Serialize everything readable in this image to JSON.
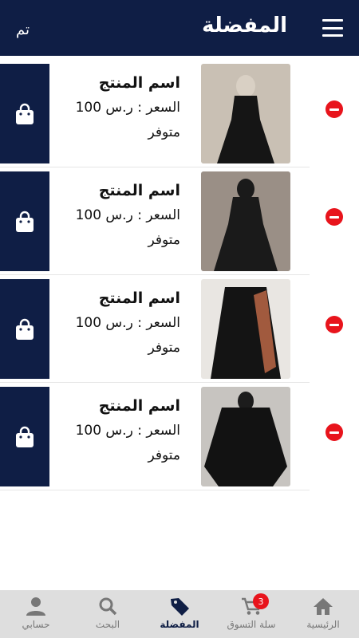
{
  "header": {
    "title": "المفضلة",
    "done_label": "تم"
  },
  "products": [
    {
      "name": "اسم المنتج",
      "price": "السعر : ر.س 100",
      "stock": "متوفر",
      "bg": "#c9c0b4",
      "garment": "#151515",
      "head": "#d9d0c4"
    },
    {
      "name": "اسم المنتج",
      "price": "السعر : ر.س 100",
      "stock": "متوفر",
      "bg": "#9a8f86",
      "garment": "#1a1a1a",
      "head": "#1a1a1a"
    },
    {
      "name": "اسم المنتج",
      "price": "السعر : ر.س 100",
      "stock": "متوفر",
      "bg": "#e9e6e2",
      "garment": "#141414",
      "head": "#a15a3e"
    },
    {
      "name": "اسم المنتج",
      "price": "السعر : ر.س 100",
      "stock": "متوفر",
      "bg": "#c7c4c0",
      "garment": "#121212",
      "head": "#1c1c1c"
    }
  ],
  "bottom_nav": [
    {
      "label": "الرئيسية",
      "icon": "home-icon"
    },
    {
      "label": "سلة التسوق",
      "icon": "cart-icon",
      "badge": "3"
    },
    {
      "label": "المفضلة",
      "icon": "tag-icon",
      "active": true
    },
    {
      "label": "البحث",
      "icon": "search-icon"
    },
    {
      "label": "حسابي",
      "icon": "person-icon"
    }
  ],
  "colors": {
    "primary": "#0f1e45",
    "danger": "#e8141c",
    "nav_bg": "#dedede"
  }
}
